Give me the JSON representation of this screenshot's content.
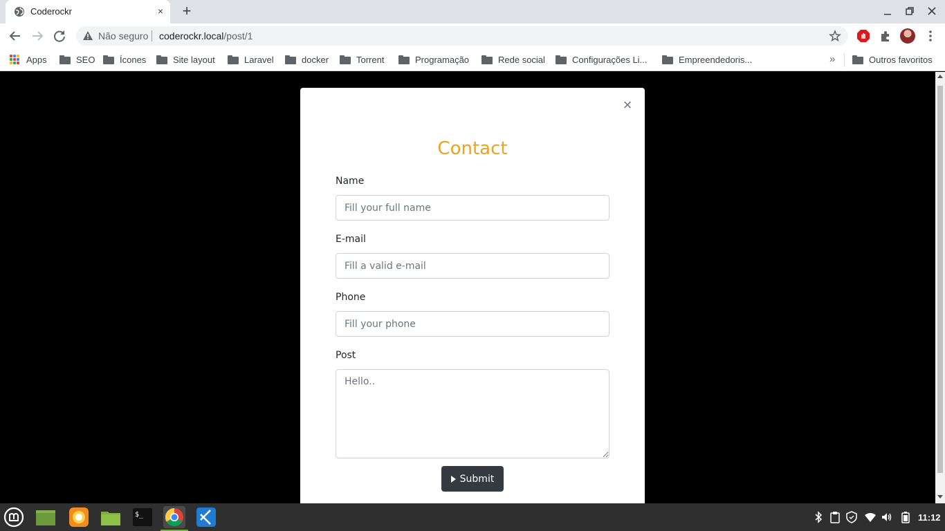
{
  "browser": {
    "tab_title": "Coderockr",
    "tab_close_glyph": "×",
    "new_tab_glyph": "+",
    "security_text": "Não seguro",
    "url_host": "coderockr.local",
    "url_path": "/post/1",
    "window_controls": [
      "minimize-icon",
      "restore-icon",
      "close-icon"
    ]
  },
  "bookmarks": {
    "apps_label": "Apps",
    "items": [
      "SEO",
      "Ícones",
      "Site layout",
      "Laravel",
      "docker",
      "Torrent",
      "Programação",
      "Rede social",
      "Configurações Li...",
      "Empreendedoris..."
    ],
    "more_glyph": "»",
    "other_label": "Outros favoritos"
  },
  "modal": {
    "close_glyph": "×",
    "title": "Contact",
    "title_color": "#eca420",
    "fields": {
      "name": {
        "label": "Name",
        "placeholder": "Fill your full name",
        "value": ""
      },
      "email": {
        "label": "E-mail",
        "placeholder": "Fill a valid e-mail",
        "value": ""
      },
      "phone": {
        "label": "Phone",
        "placeholder": "Fill your phone",
        "value": ""
      },
      "post": {
        "label": "Post",
        "placeholder": "Hello..",
        "value": ""
      }
    },
    "submit_label": "Submit"
  },
  "taskbar": {
    "apps": [
      "mint-menu-icon",
      "desktop-icon",
      "firefox-icon",
      "files-icon",
      "terminal-icon",
      "chrome-icon",
      "vscode-icon"
    ],
    "tray": [
      "bluetooth-icon",
      "clipboard-icon",
      "shield-icon",
      "wifi-icon",
      "volume-icon",
      "battery-icon"
    ],
    "clock": "11:12"
  }
}
